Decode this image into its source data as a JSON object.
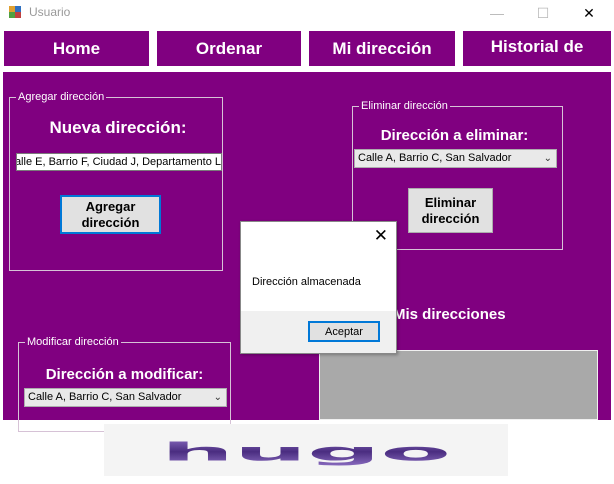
{
  "window": {
    "title": "Usuario",
    "minimize_glyph": "—",
    "maximize_glyph": "☐",
    "close_glyph": "✕"
  },
  "nav": {
    "home": "Home",
    "order": "Ordenar",
    "my_address": "Mi dirección",
    "history": "Historial de"
  },
  "add_group": {
    "title": "Agregar dirección",
    "heading": "Nueva dirección:",
    "input_value": "Calle E, Barrio F, Ciudad J, Departamento L",
    "button": "Agregar dirección"
  },
  "delete_group": {
    "title": "Eliminar dirección",
    "heading": "Dirección a eliminar:",
    "selected": "Calle A, Barrio C, San Salvador",
    "button": "Eliminar dirección"
  },
  "modify_group": {
    "title": "Modificar dirección",
    "heading": "Dirección a modificar:",
    "selected": "Calle A, Barrio C, San Salvador"
  },
  "my_addresses": {
    "heading": "Mis direcciones"
  },
  "dialog": {
    "message": "Dirección almacenada",
    "button": "Aceptar",
    "close_glyph": "✕"
  },
  "logo": {
    "text": "hugo"
  },
  "colors": {
    "brand_purple": "#800080",
    "accent_blue": "#0078d7",
    "logo_purple": "#5a3d8f"
  },
  "icons": {
    "app": "app-window-icon",
    "chevron": "chevron-down-icon"
  }
}
